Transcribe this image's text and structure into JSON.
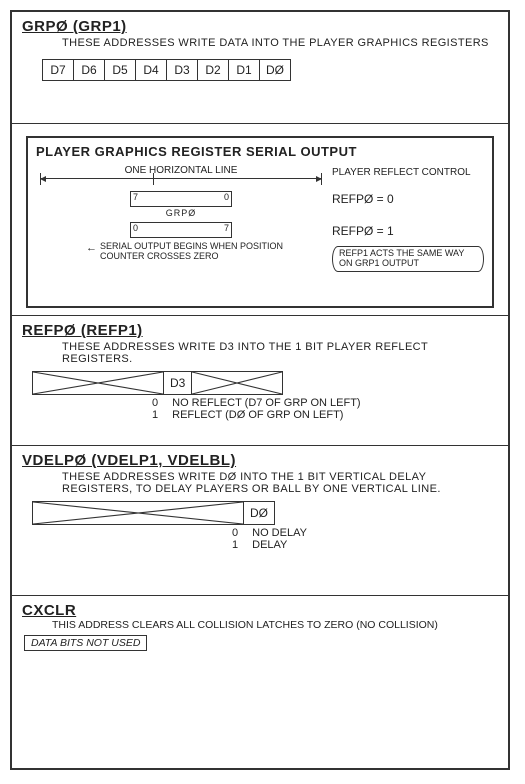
{
  "grp": {
    "title": "GRPØ (GRP1)",
    "desc": "THESE ADDRESSES WRITE DATA INTO THE PLAYER GRAPHICS REGISTERS",
    "bits": [
      "D7",
      "D6",
      "D5",
      "D4",
      "D3",
      "D2",
      "D1",
      "DØ"
    ]
  },
  "serial": {
    "title": "PLAYER GRAPHICS REGISTER SERIAL OUTPUT",
    "hlabel": "ONE HORIZONTAL LINE",
    "grp_label": "GRPØ",
    "reg_a_left": "7",
    "reg_a_right": "0",
    "reg_b_left": "0",
    "reg_b_right": "7",
    "note": "SERIAL OUTPUT BEGINS WHEN POSITION COUNTER CROSSES ZERO",
    "reflect_title": "PLAYER REFLECT CONTROL",
    "ref0": "REFPØ = 0",
    "ref1": "REFPØ = 1",
    "paren": "REFP1 ACTS THE SAME WAY ON GRP1 OUTPUT"
  },
  "refp": {
    "title": "REFPØ (REFP1)",
    "desc": "THESE ADDRESSES WRITE D3 INTO THE 1 BIT PLAYER REFLECT REGISTERS.",
    "bit": "D3",
    "legend0_k": "0",
    "legend0_v": "NO REFLECT (D7 OF GRP ON LEFT)",
    "legend1_k": "1",
    "legend1_v": "REFLECT (DØ OF GRP ON LEFT)"
  },
  "vdel": {
    "title": "VDELPØ (VDELP1, VDELBL)",
    "desc": "THESE ADDRESSES WRITE DØ INTO THE 1 BIT VERTICAL DELAY REGISTERS, TO DELAY PLAYERS OR BALL BY ONE VERTICAL LINE.",
    "bit": "DØ",
    "legend0_k": "0",
    "legend0_v": "NO DELAY",
    "legend1_k": "1",
    "legend1_v": "DELAY"
  },
  "cxclr": {
    "title": "CXCLR",
    "desc": "THIS ADDRESS CLEARS ALL COLLISION LATCHES TO ZERO (NO COLLISION)",
    "notused": "DATA BITS NOT USED"
  }
}
